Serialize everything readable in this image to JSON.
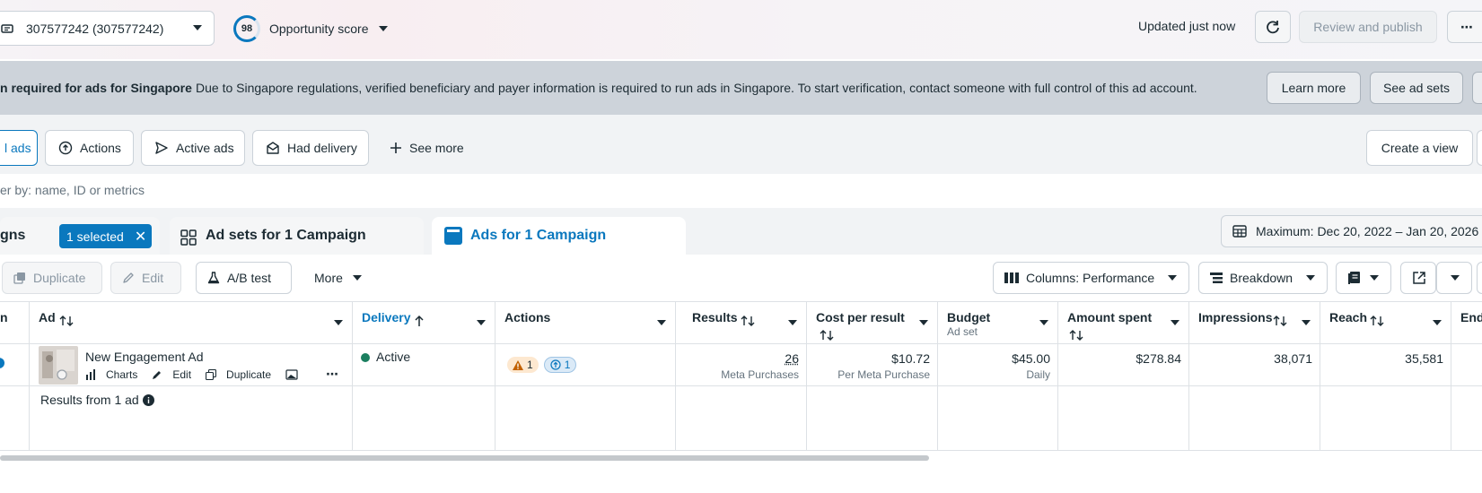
{
  "topbar": {
    "account_label": "307577242 (307577242)",
    "opportunity_score": "98",
    "opportunity_label": "Opportunity score",
    "updated_text": "Updated just now",
    "review_label": "Review and publish",
    "more_label": "⋯"
  },
  "banner": {
    "title": "n required for ads for Singapore",
    "text": "Due to Singapore regulations, verified beneficiary and payer information is required to run ads in Singapore. To start verification, contact someone with full control of this ad account.",
    "learn_more": "Learn more",
    "see_ad_sets": "See ad sets"
  },
  "views": {
    "all_ads": "l ads",
    "actions": "Actions",
    "active_ads": "Active ads",
    "had_delivery": "Had delivery",
    "see_more": "See more",
    "create_view": "Create a view"
  },
  "search": {
    "placeholder": "er by: name, ID or metrics"
  },
  "level_tabs": {
    "campaigns": "gns",
    "selected_badge": "1 selected",
    "ad_sets": "Ad sets for 1 Campaign",
    "ads": "Ads for 1 Campaign",
    "date_range": "Maximum: Dec 20, 2022 – Jan 20, 2026"
  },
  "toolbar": {
    "duplicate": "Duplicate",
    "edit": "Edit",
    "ab_test": "A/B test",
    "more": "More",
    "columns": "Columns: Performance",
    "breakdown": "Breakdown"
  },
  "table": {
    "headers": {
      "ad": "Ad",
      "delivery": "Delivery",
      "actions": "Actions",
      "results": "Results",
      "cost_per_result": "Cost per result",
      "budget": "Budget",
      "budget_sub": "Ad set",
      "amount_spent": "Amount spent",
      "impressions": "Impressions",
      "reach": "Reach",
      "ends": "End"
    },
    "row": {
      "ad_name": "New Engagement Ad",
      "charts": "Charts",
      "edit": "Edit",
      "duplicate": "Duplicate",
      "delivery": "Active",
      "warning_count": "1",
      "info_count": "1",
      "results": "26",
      "results_sub": "Meta Purchases",
      "cost_per_result": "$10.72",
      "cost_sub": "Per Meta Purchase",
      "budget": "$45.00",
      "budget_sub": "Daily",
      "amount_spent": "$278.84",
      "impressions": "38,071",
      "reach": "35,581"
    },
    "summary": "Results from 1 ad"
  },
  "colors": {
    "accent": "#0a78be",
    "active_dot": "#1b7f5f",
    "banner_bg": "#cdd3da"
  }
}
